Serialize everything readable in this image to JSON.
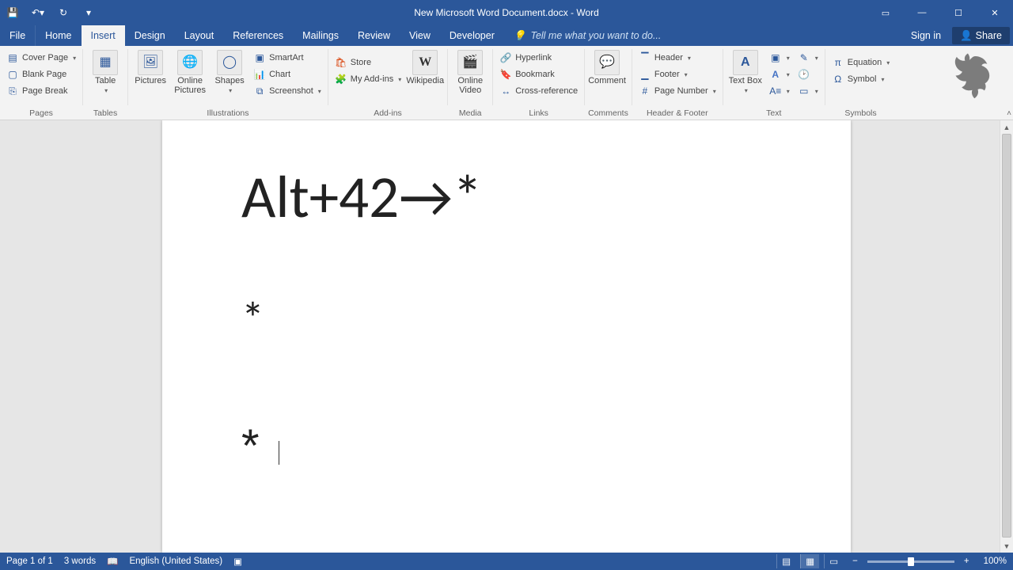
{
  "title": "New Microsoft Word Document.docx - Word",
  "tabs": {
    "file": "File",
    "home": "Home",
    "insert": "Insert",
    "design": "Design",
    "layout": "Layout",
    "references": "References",
    "mailings": "Mailings",
    "review": "Review",
    "view": "View",
    "developer": "Developer"
  },
  "tell_me": "Tell me what you want to do...",
  "menu_right": {
    "signin": "Sign in",
    "share": "Share"
  },
  "ribbon": {
    "pages": {
      "label": "Pages",
      "cover": "Cover Page",
      "blank": "Blank Page",
      "break": "Page Break"
    },
    "tables": {
      "label": "Tables",
      "table": "Table"
    },
    "illustrations": {
      "label": "Illustrations",
      "pictures": "Pictures",
      "online_pictures": "Online Pictures",
      "shapes": "Shapes",
      "smartart": "SmartArt",
      "chart": "Chart",
      "screenshot": "Screenshot"
    },
    "addins": {
      "label": "Add-ins",
      "store": "Store",
      "myaddins": "My Add-ins",
      "wikipedia": "Wikipedia"
    },
    "media": {
      "label": "Media",
      "online_video": "Online Video"
    },
    "links": {
      "label": "Links",
      "hyperlink": "Hyperlink",
      "bookmark": "Bookmark",
      "crossref": "Cross-reference"
    },
    "comments": {
      "label": "Comments",
      "comment": "Comment"
    },
    "headerfooter": {
      "label": "Header & Footer",
      "header": "Header",
      "footer": "Footer",
      "pagenum": "Page Number"
    },
    "text": {
      "label": "Text",
      "textbox": "Text Box"
    },
    "symbols": {
      "label": "Symbols",
      "equation": "Equation",
      "symbol": "Symbol"
    }
  },
  "doc": {
    "line1": "Alt+42→*",
    "line2": "*",
    "line3": "*"
  },
  "status": {
    "page": "Page 1 of 1",
    "words": "3 words",
    "lang": "English (United States)",
    "zoom": "100%"
  }
}
